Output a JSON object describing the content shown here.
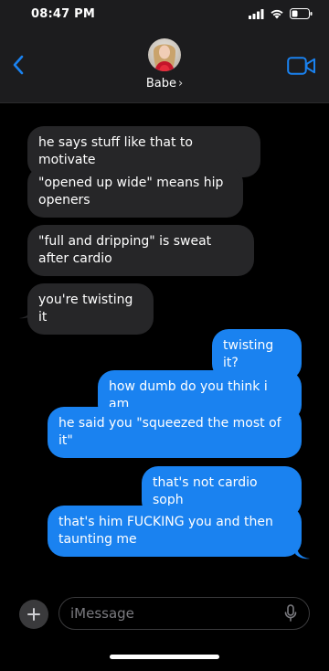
{
  "status_bar": {
    "time": "08:47 PM"
  },
  "header": {
    "contact_name": "Babe",
    "contact_chevron": "›"
  },
  "messages": [
    {
      "side": "in",
      "text": "he says stuff like that to motivate"
    },
    {
      "side": "in",
      "text": "\"opened up wide\" means hip openers"
    },
    {
      "side": "in",
      "text": "\"full and dripping\" is sweat after cardio"
    },
    {
      "side": "in",
      "text": "you're twisting it"
    },
    {
      "side": "out",
      "text": "twisting it?"
    },
    {
      "side": "out",
      "text": "how dumb do you think i am"
    },
    {
      "side": "out",
      "text": "he said you \"squeezed the most of it\""
    },
    {
      "side": "out",
      "text": "that's not cardio soph"
    },
    {
      "side": "out",
      "text": "that's him FUCKING you and then taunting me"
    }
  ],
  "composer": {
    "placeholder": "iMessage"
  },
  "colors": {
    "incoming_bubble": "#262628",
    "outgoing_bubble": "#1a82f0",
    "accent": "#1a82f0",
    "header_bg": "#1c1c1e"
  },
  "icons": [
    "back-chevron-icon",
    "video-camera-icon",
    "plus-icon",
    "microphone-icon",
    "signal-icon",
    "wifi-icon",
    "battery-icon"
  ]
}
